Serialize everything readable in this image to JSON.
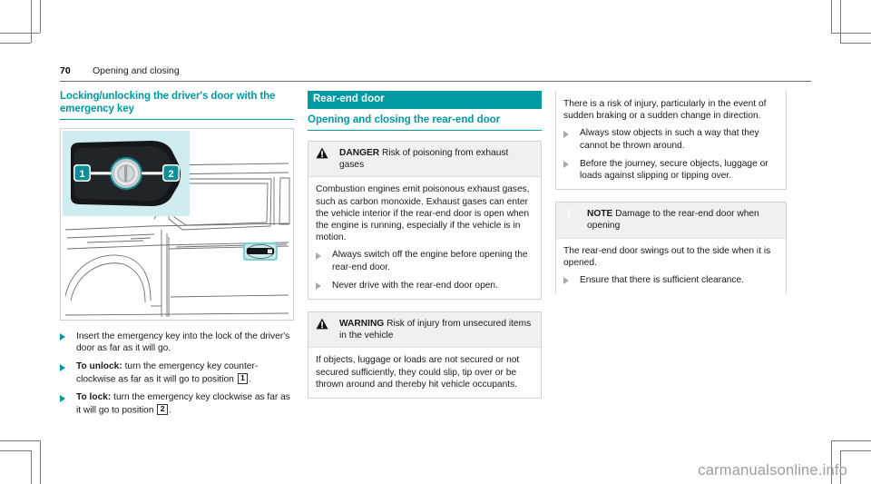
{
  "colors": {
    "teal": "#009aa3",
    "teal_light_bg": "#cfecee",
    "box_border": "#d2d2d2",
    "box_head_bg": "#f0f0f0",
    "bullet_grey": "#a9a9a9",
    "watermark": "#9d9d9d",
    "text": "#1a1a1a"
  },
  "header": {
    "page_number": "70",
    "chapter_title": "Opening and closing"
  },
  "col1": {
    "heading": "Locking/unlocking the driver's door with the emergency key",
    "figure": {
      "name": "driver-door-lock-cylinder-illustration",
      "callouts": [
        {
          "id": "1",
          "label": "1"
        },
        {
          "id": "2",
          "label": "2"
        }
      ]
    },
    "bullets": [
      {
        "lead": "",
        "text": "Insert the emergency key into the lock of the driver's door as far as it will go."
      },
      {
        "lead": "To unlock:",
        "text": " turn the emergency key counter-clockwise as far as it will go to position ",
        "posmark": "1",
        "tail": "."
      },
      {
        "lead": "To lock:",
        "text": " turn the emergency key clockwise as far as it will go to position ",
        "posmark": "2",
        "tail": "."
      }
    ]
  },
  "col2": {
    "section_band": "Rear-end door",
    "subheading": "Opening and closing the rear-end door",
    "danger_box": {
      "glyph": "warning-triangle-icon",
      "label": "DANGER",
      "title": " Risk of poisoning from exhaust gases",
      "body": "Combustion engines emit poisonous exhaust gases, such as carbon monoxide. Exhaust gases can enter the vehicle interior if the rear-end door is open when the engine is running, especially if the vehicle is in motion.",
      "bullets": [
        "Always switch off the engine before opening the rear-end door.",
        "Never drive with the rear-end door open."
      ]
    },
    "warning_box": {
      "glyph": "warning-triangle-icon",
      "label": "WARNING",
      "title": " Risk of injury from unsecured items in the vehicle",
      "body": "If objects, luggage or loads are not secured or not secured sufficiently, they could slip, tip over or be thrown around and thereby hit vehicle occupants."
    }
  },
  "col3": {
    "warning_continuation": {
      "body": "There is a risk of injury, particularly in the event of sudden braking or a sudden change in direction.",
      "bullets": [
        "Always stow objects in such a way that they cannot be thrown around.",
        "Before the journey, secure objects, luggage or loads against slipping or tipping over."
      ]
    },
    "note_box": {
      "glyph": "note-exclamation-icon",
      "label": "NOTE",
      "title": " Damage to the rear-end door when opening",
      "body": "The rear-end door swings out to the side when it is opened.",
      "bullets": [
        "Ensure that there is sufficient clearance."
      ]
    }
  },
  "watermark": {
    "text": "carmanualsonline.info"
  }
}
